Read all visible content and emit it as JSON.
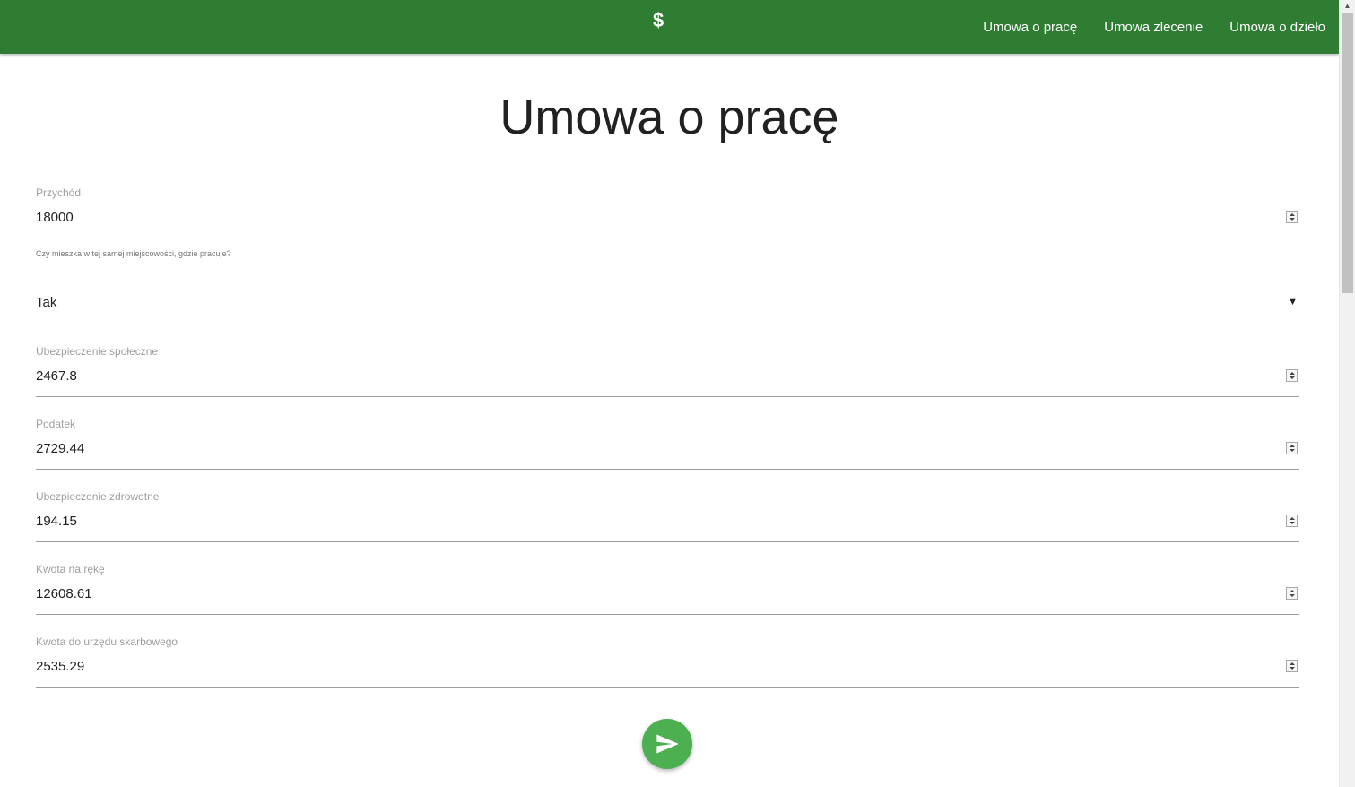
{
  "navbar": {
    "brand": "$",
    "links": [
      "Umowa o pracę",
      "Umowa zlecenie",
      "Umowa o dzieło"
    ],
    "color": "#2e7d32"
  },
  "page": {
    "title": "Umowa o pracę"
  },
  "form": {
    "income": {
      "label": "Przychód",
      "value": "18000"
    },
    "residence": {
      "caption": "Czy mieszka w tej samej miejscowości, gdzie pracuje?",
      "selected": "Tak"
    },
    "social": {
      "label": "Ubezpieczenie społeczne",
      "value": "2467.8"
    },
    "tax": {
      "label": "Podatek",
      "value": "2729.44"
    },
    "health": {
      "label": "Ubezpieczenie zdrowotne",
      "value": "194.15"
    },
    "net": {
      "label": "Kwota na rękę",
      "value": "12608.61"
    },
    "office": {
      "label": "Kwota do urzędu skarbowego",
      "value": "2535.29"
    }
  },
  "submit": {
    "icon": "send-icon",
    "color": "#4caf50"
  }
}
